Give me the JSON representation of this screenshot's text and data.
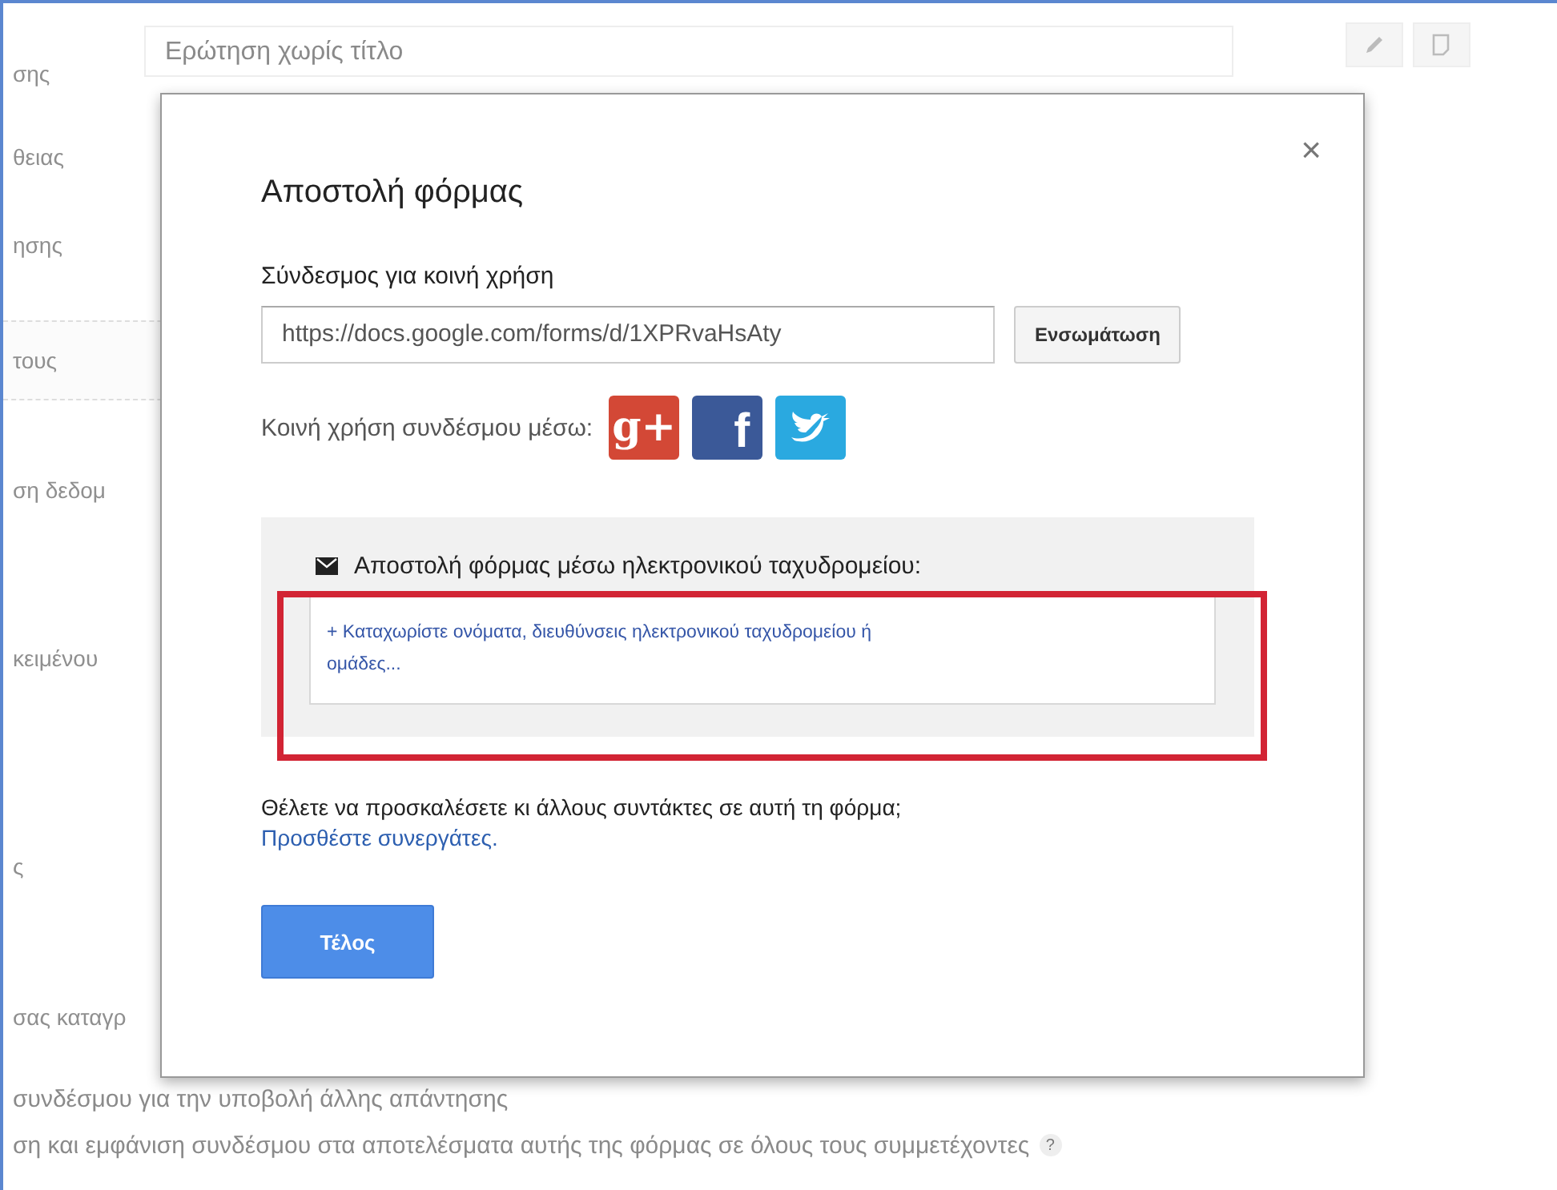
{
  "background": {
    "title_field": {
      "placeholder": "Ερώτηση χωρίς τίτλο"
    },
    "labels": [
      {
        "text": "σης",
        "kind": "label"
      },
      {
        "text": "θειας",
        "kind": "label"
      },
      {
        "text": "ησης",
        "kind": "label"
      },
      {
        "text": "τους",
        "kind": "section"
      },
      {
        "text": "ση δεδομ",
        "kind": "label"
      },
      {
        "text": "κειμένου",
        "kind": "tab"
      },
      {
        "text": "ς",
        "kind": "label"
      },
      {
        "text": "σας καταγρ",
        "kind": "label"
      },
      {
        "text": "συνδέσμου για την υποβολή άλλης απάντησης",
        "kind": "option"
      },
      {
        "text": "ση και εμφάνιση συνδέσμου στα αποτελέσματα αυτής της φόρμας σε όλους τους συμμετέχοντες",
        "kind": "option",
        "help": "?"
      }
    ]
  },
  "dialog": {
    "close": "×",
    "title": "Αποστολή φόρμας",
    "link_label": "Σύνδεσμος για κοινή χρήση",
    "link_field": {
      "value": "https://docs.google.com/forms/d/1XPRvaHsAty"
    },
    "embed_button": "Ενσωμάτωση",
    "share_label": "Κοινή χρήση συνδέσμου μέσω:",
    "share_services": [
      {
        "kind": "gplus",
        "mark": "g+"
      },
      {
        "kind": "facebook",
        "mark": "f"
      },
      {
        "kind": "twitter"
      }
    ],
    "email": {
      "label": "Αποστολή φόρμας μέσω ηλεκτρονικού ταχυδρομείου:",
      "recipients": {
        "placeholder": "+ Καταχωρίστε ονόματα, διευθύνσεις ηλεκτρονικού ταχυδρομείου ή ομάδες..."
      },
      "highlighted": true
    },
    "collaborators_question": "Θέλετε να προσκαλέσετε κι άλλους συντάκτες σε αυτή τη φόρμα;",
    "collaborators_link": "Προσθέστε συνεργάτες.",
    "done_button": "Τέλος"
  }
}
